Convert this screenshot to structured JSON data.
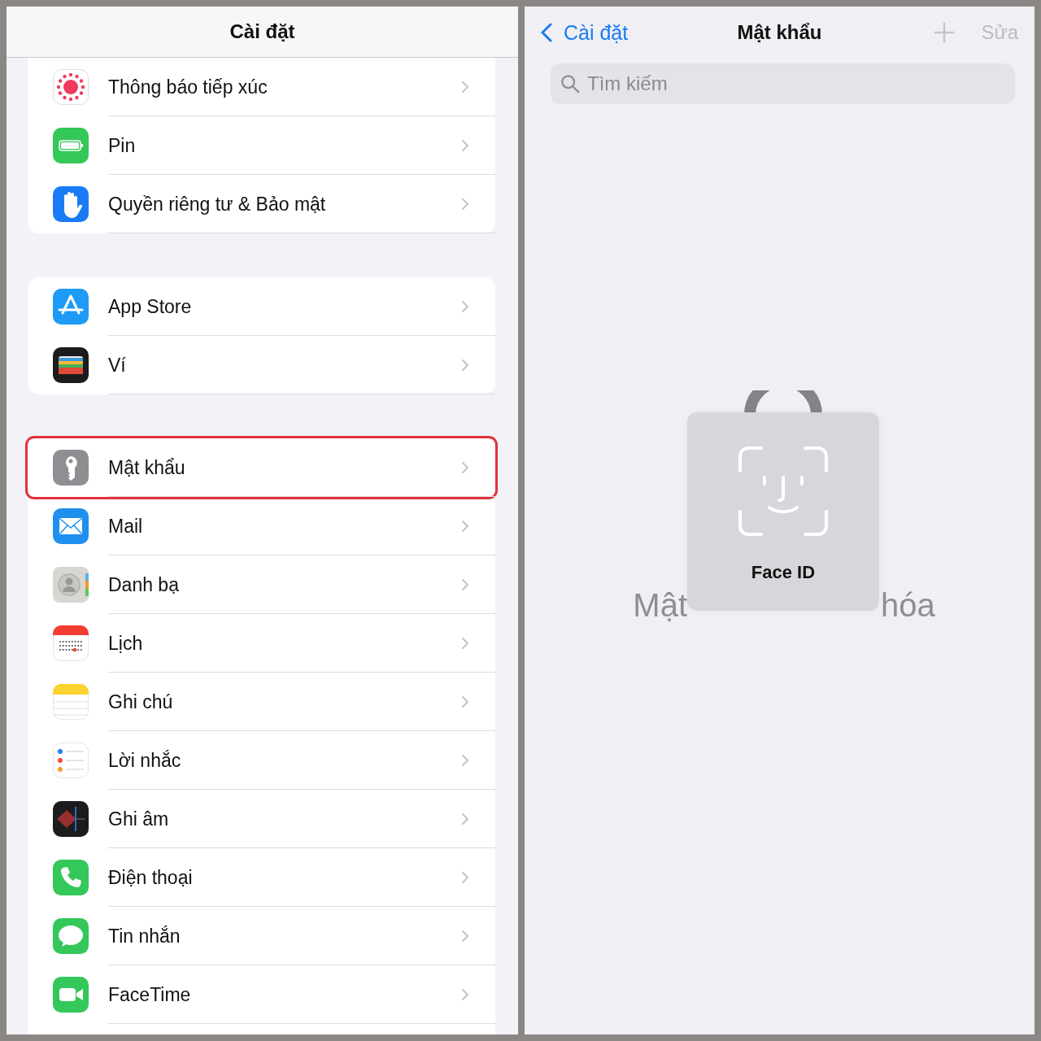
{
  "settings": {
    "title": "Cài đặt",
    "groups": [
      {
        "items": [
          {
            "label": "Thông báo tiếp xúc",
            "kind": "exposure",
            "highlighted": false
          },
          {
            "label": "Pin",
            "kind": "battery",
            "highlighted": false
          },
          {
            "label": "Quyền riêng tư & Bảo mật",
            "kind": "privacy",
            "highlighted": false
          }
        ]
      },
      {
        "items": [
          {
            "label": "App Store",
            "kind": "appstore",
            "highlighted": false
          },
          {
            "label": "Ví",
            "kind": "wallet",
            "highlighted": false
          }
        ]
      },
      {
        "items": [
          {
            "label": "Mật khẩu",
            "kind": "passwords",
            "highlighted": true
          },
          {
            "label": "Mail",
            "kind": "mail",
            "highlighted": false
          },
          {
            "label": "Danh bạ",
            "kind": "contacts",
            "highlighted": false
          },
          {
            "label": "Lịch",
            "kind": "calendar",
            "highlighted": false
          },
          {
            "label": "Ghi chú",
            "kind": "notes",
            "highlighted": false
          },
          {
            "label": "Lời nhắc",
            "kind": "reminders",
            "highlighted": false
          },
          {
            "label": "Ghi âm",
            "kind": "voicememos",
            "highlighted": false
          },
          {
            "label": "Điện thoại",
            "kind": "phone",
            "highlighted": false
          },
          {
            "label": "Tin nhắn",
            "kind": "messages",
            "highlighted": false
          },
          {
            "label": "FaceTime",
            "kind": "facetime",
            "highlighted": false
          }
        ]
      }
    ]
  },
  "passwords": {
    "back": "Cài đặt",
    "title": "Mật khẩu",
    "edit": {
      "label": "Sửa",
      "disabled": true
    },
    "add": {
      "disabled": true
    },
    "search": {
      "placeholder": "Tìm kiếm"
    },
    "face_id": {
      "label": "Face ID"
    },
    "locked_message_fragments": [
      "Mật",
      "hóa"
    ]
  }
}
